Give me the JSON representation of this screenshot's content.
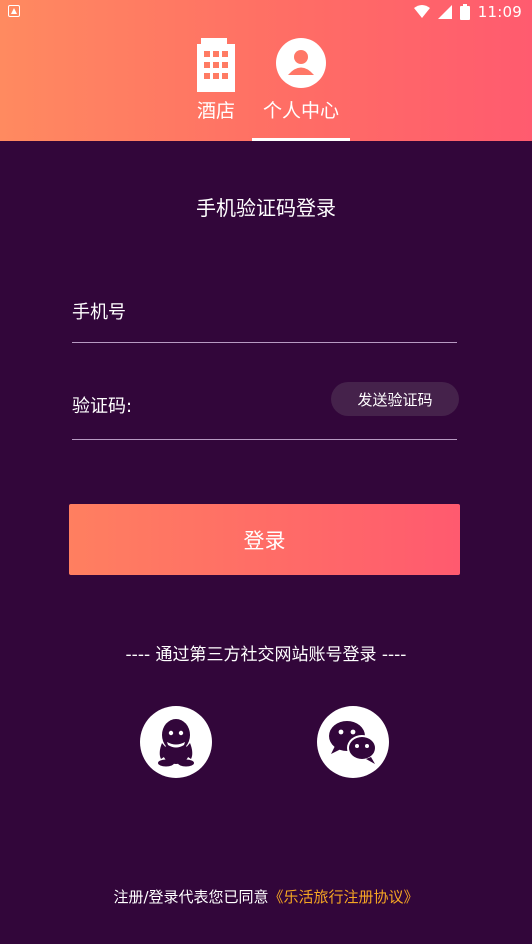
{
  "status_bar": {
    "time": "11:09",
    "icons": [
      "wifi-icon",
      "signal-icon",
      "battery-icon"
    ]
  },
  "tabs": [
    {
      "label": "酒店",
      "icon": "hotel-building-icon",
      "selected": false
    },
    {
      "label": "个人中心",
      "icon": "user-avatar-icon",
      "selected": true
    }
  ],
  "login": {
    "title": "手机验证码登录",
    "phone_label": "手机号",
    "code_label": "验证码:",
    "send_code_button": "发送验证码",
    "login_button": "登录"
  },
  "third_party": {
    "title": "---- 通过第三方社交网站账号登录 ----",
    "providers": [
      "qq",
      "wechat"
    ]
  },
  "agreement": {
    "prefix": "注册/登录代表您已同意",
    "link": "《乐活旅行注册协议》"
  },
  "colors": {
    "header_gradient_start": "#ff8a60",
    "header_gradient_end": "#ff5b6f",
    "background": "#32063a",
    "agreement_link": "#f5a623",
    "send_code_bg": "#45224b"
  }
}
